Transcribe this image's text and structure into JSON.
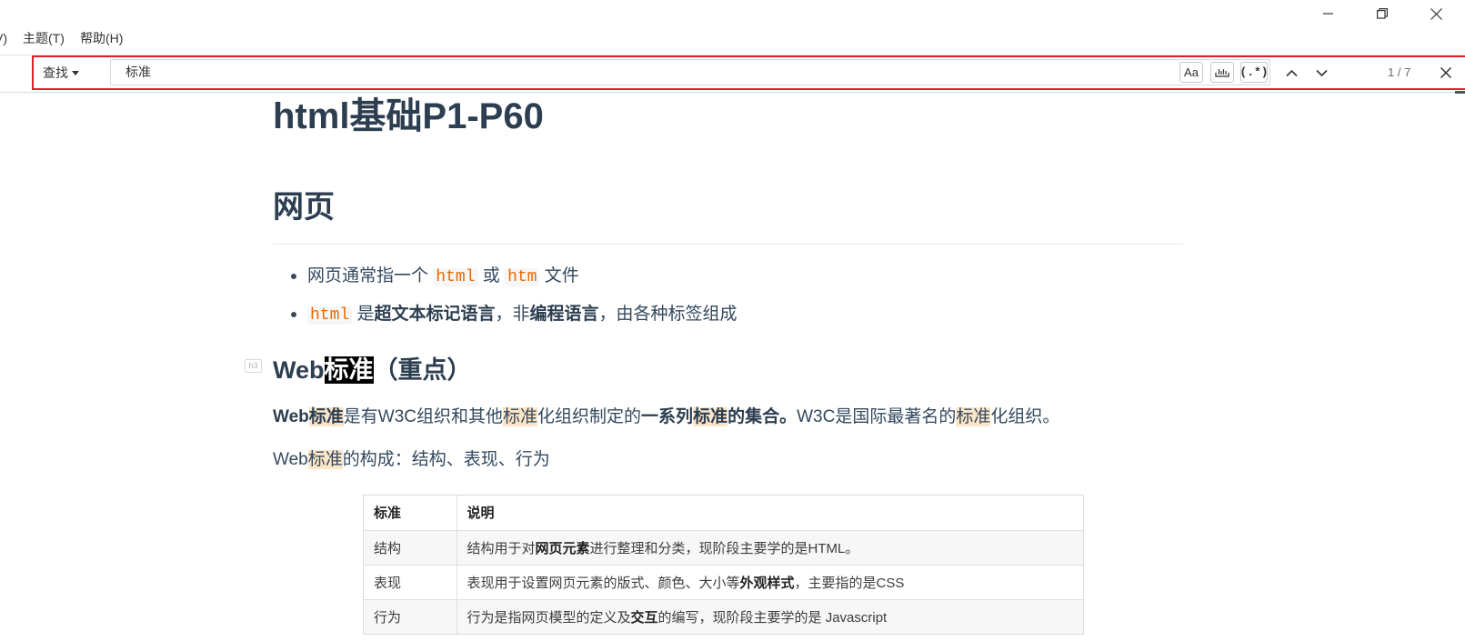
{
  "window": {
    "minimize_icon": "minimize-icon",
    "restore_icon": "restore-icon",
    "close_icon": "close-icon"
  },
  "menubar": {
    "items": [
      "V)",
      "主题(T)",
      "帮助(H)"
    ]
  },
  "findbar": {
    "mode": "查找",
    "mode_icon": "caret-down-icon",
    "query": "标准",
    "case_toggle": "Aa",
    "whole_word_icon": "whole-word-icon",
    "regex_toggle": "(.*)",
    "prev_icon": "chevron-up-icon",
    "next_icon": "chevron-down-icon",
    "counter": "1 / 7",
    "close_icon": "close-icon",
    "annotation_border_color": "#e0202a"
  },
  "colors": {
    "heading": "#2c3e50",
    "text": "#34495e",
    "inline_code": "#e96900",
    "match_highlight": "#fde6c8",
    "current_match_bg": "#000000",
    "current_match_text": "#ffffff"
  },
  "document": {
    "title": "html基础P1-P60",
    "section_heading": "网页",
    "list": [
      [
        "网页通常指一个 ",
        "html",
        " 或 ",
        "htm",
        " 文件"
      ],
      [
        "html",
        " 是",
        "超文本标记语言",
        "，非",
        "编程语言",
        "，由各种标签组成"
      ]
    ],
    "subheading": {
      "badge": "h3",
      "segments": [
        "Web",
        "标准",
        "（重点）"
      ]
    },
    "paragraph1": [
      "Web",
      "标准",
      "是有W3C组织和其他",
      "标准",
      "化组织制定的",
      "一系列",
      "标准",
      "的集合。",
      "W3C是国际最著名的",
      "标准",
      "化组织。"
    ],
    "paragraph2": [
      "Web",
      "标准",
      "的构成：结构、表现、行为"
    ],
    "table_image": {
      "headers": [
        "标准",
        "说明"
      ],
      "rows": [
        {
          "name": "结构",
          "desc": [
            "结构用于对",
            "网页元素",
            "进行整理和分类，现阶段主要学的是HTML。"
          ]
        },
        {
          "name": "表现",
          "desc": [
            "表现用于设置网页元素的版式、颜色、大小等",
            "外观样式",
            "，主要指的是CSS"
          ]
        },
        {
          "name": "行为",
          "desc": [
            "行为是指网页模型的定义及",
            "交互",
            "的编写，现阶段主要学的是 Javascript"
          ]
        }
      ]
    }
  }
}
